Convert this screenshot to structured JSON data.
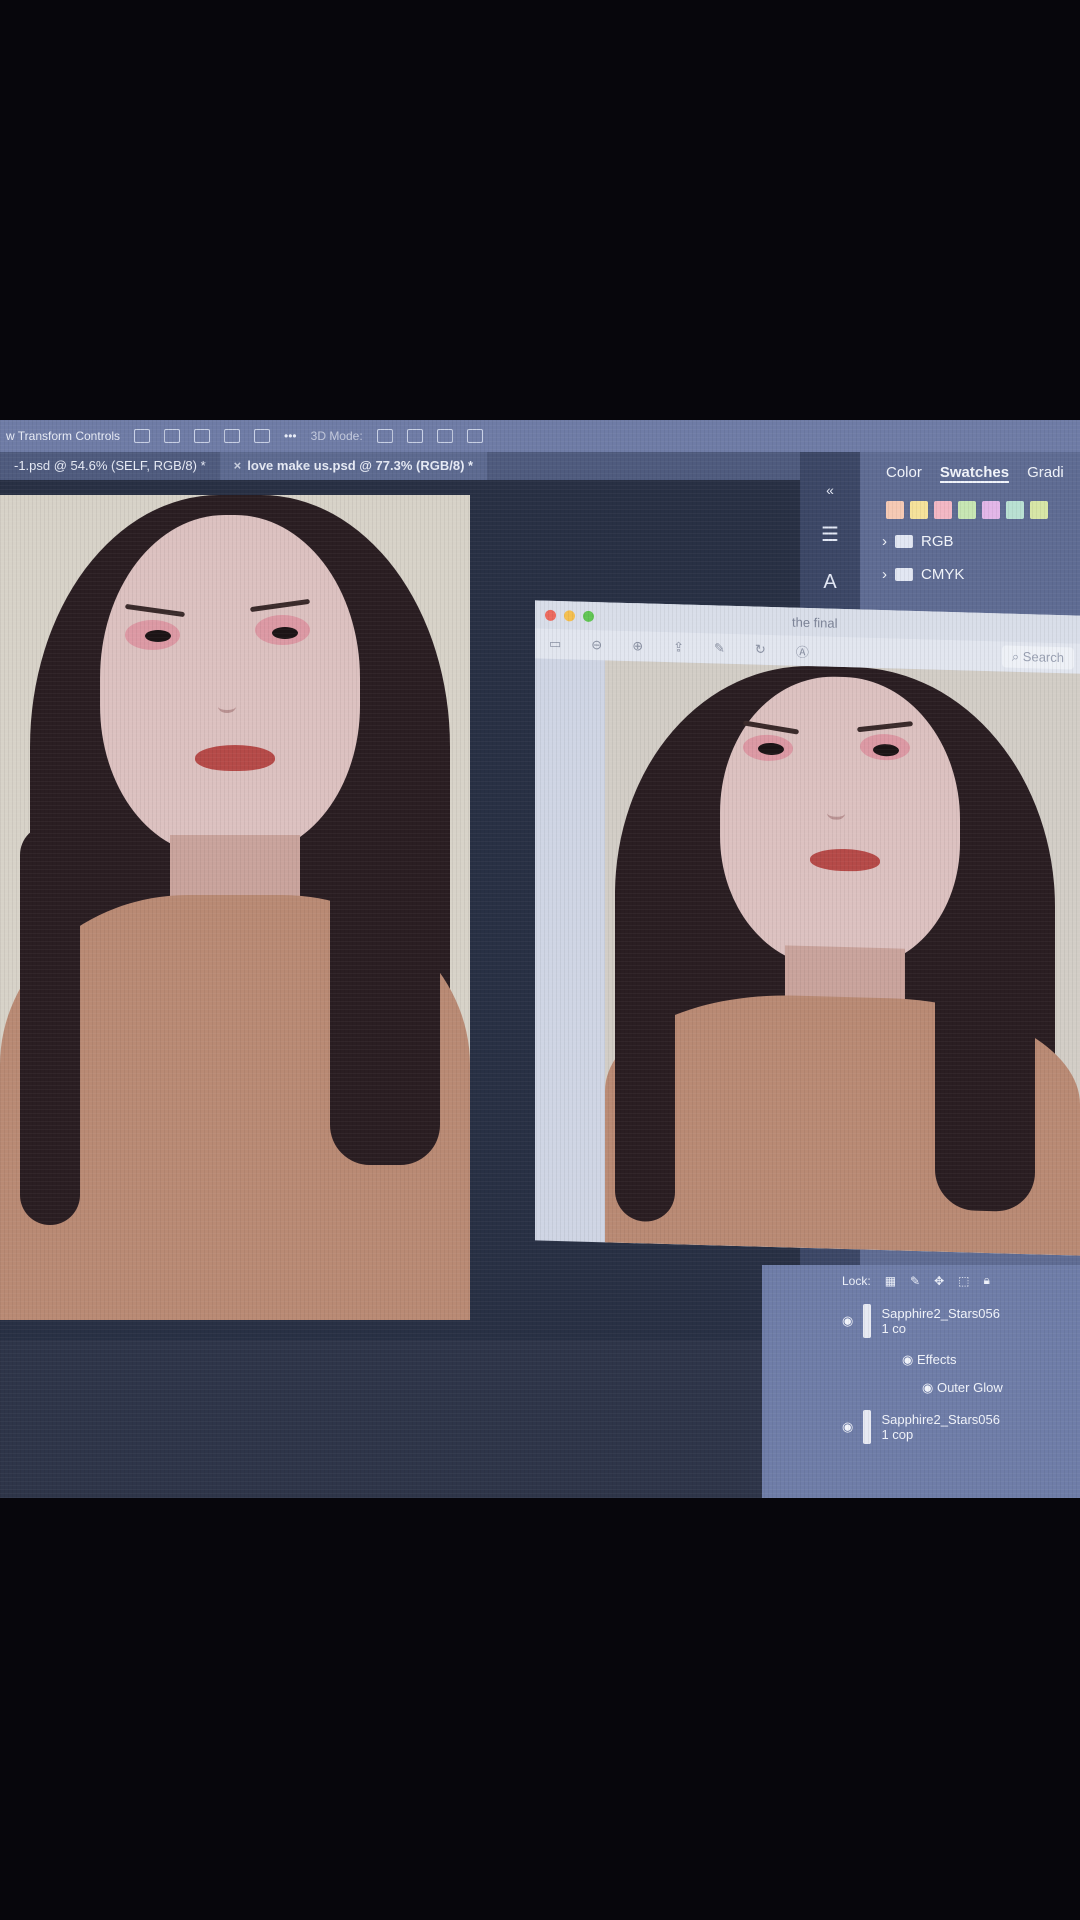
{
  "app": {
    "options_bar_label": "w Transform Controls",
    "options_bar_mode": "3D Mode:"
  },
  "document_tabs": [
    {
      "label": "-1.psd @ 54.6% (SELF, RGB/8) *",
      "active": false
    },
    {
      "label": "love make us.psd @ 77.3% (RGB/8) *",
      "active": true
    }
  ],
  "color_panel": {
    "tabs": [
      "Color",
      "Swatches",
      "Gradi"
    ],
    "active_tab": "Swatches",
    "swatch_colors": [
      "#f5c9b4",
      "#f5e29a",
      "#f3b7c4",
      "#c7e6b3",
      "#e2b6e8",
      "#b9e1d3",
      "#d7e6a6"
    ],
    "folders": [
      "RGB",
      "CMYK"
    ]
  },
  "preview_window": {
    "title": "the final",
    "search_placeholder": "Search"
  },
  "layers_panel": {
    "lock_label": "Lock:",
    "layers": [
      {
        "name": "Sapphire2_Stars056 1 co",
        "visible": true
      },
      {
        "name": "Sapphire2_Stars056 1 cop",
        "visible": true
      }
    ],
    "effects_label": "Effects",
    "effect_item": "Outer Glow"
  },
  "colors": {
    "options_bar": "#6f7ca6",
    "panel": "#5f6c93",
    "canvas": "#2e3549"
  }
}
